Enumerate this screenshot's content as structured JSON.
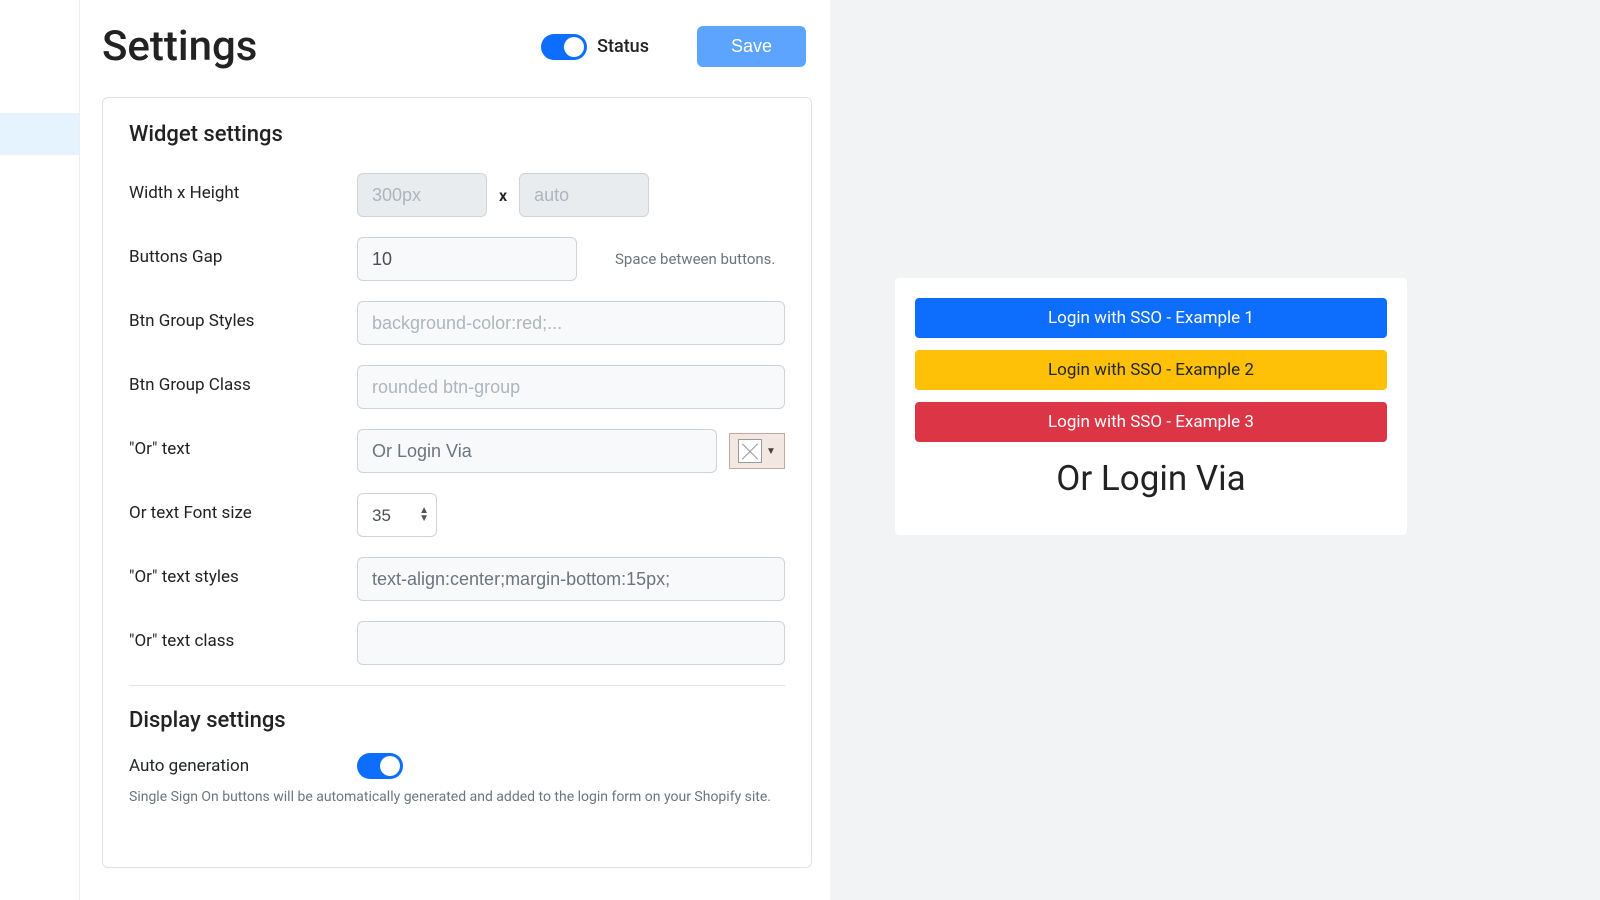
{
  "header": {
    "title": "Settings",
    "status_label": "Status",
    "save_label": "Save"
  },
  "widget": {
    "section_title": "Widget settings",
    "width_height_label": "Width x Height",
    "width_placeholder": "300px",
    "height_placeholder": "auto",
    "x_sep": "x",
    "buttons_gap_label": "Buttons Gap",
    "buttons_gap_value": "10",
    "buttons_gap_help": "Space between buttons.",
    "btn_group_styles_label": "Btn Group Styles",
    "btn_group_styles_placeholder": "background-color:red;...",
    "btn_group_class_label": "Btn Group Class",
    "btn_group_class_placeholder": "rounded btn-group",
    "or_text_label": "\"Or\" text",
    "or_text_value": "Or Login Via",
    "or_font_label": "Or text Font size",
    "or_font_value": "35",
    "or_styles_label": "\"Or\" text styles",
    "or_styles_value": "text-align:center;margin-bottom:15px;",
    "or_class_label": "\"Or\" text class",
    "or_class_value": ""
  },
  "display": {
    "section_title": "Display settings",
    "auto_label": "Auto generation",
    "auto_hint": "Single Sign On buttons will be automatically generated and added to the login form on your Shopify site."
  },
  "preview": {
    "btn1": "Login with SSO - Example 1",
    "btn2": "Login with SSO - Example 2",
    "btn3": "Login with SSO - Example 3",
    "or_text": "Or Login Via"
  },
  "colors": {
    "accent": "#0d6efd",
    "warn": "#ffc107",
    "danger": "#dc3545"
  }
}
